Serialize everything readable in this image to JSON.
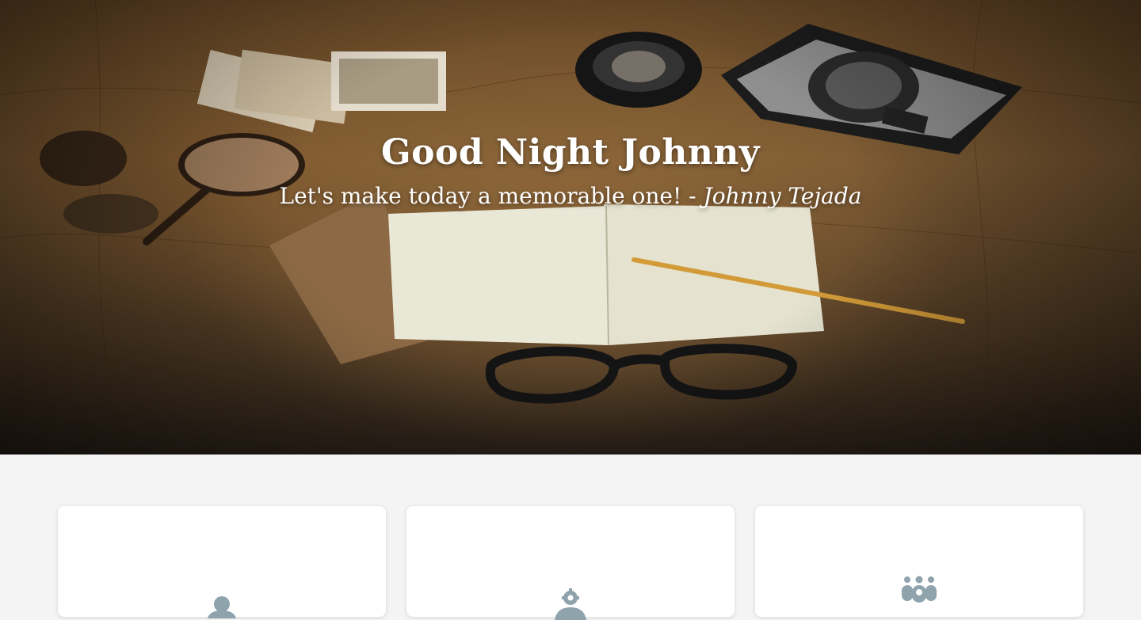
{
  "hero": {
    "greeting": "Good Night Johnny",
    "quote": "Let's make today a memorable one!",
    "separator": " - ",
    "author": "Johnny Tejada"
  },
  "cards": [
    {
      "icon": "user-icon"
    },
    {
      "icon": "user-cog-icon"
    },
    {
      "icon": "users-group-icon"
    }
  ],
  "colors": {
    "page_background": "#f4f4f4",
    "card_background": "#ffffff",
    "icon_color": "#8fa3ad",
    "hero_text": "#ffffff"
  }
}
